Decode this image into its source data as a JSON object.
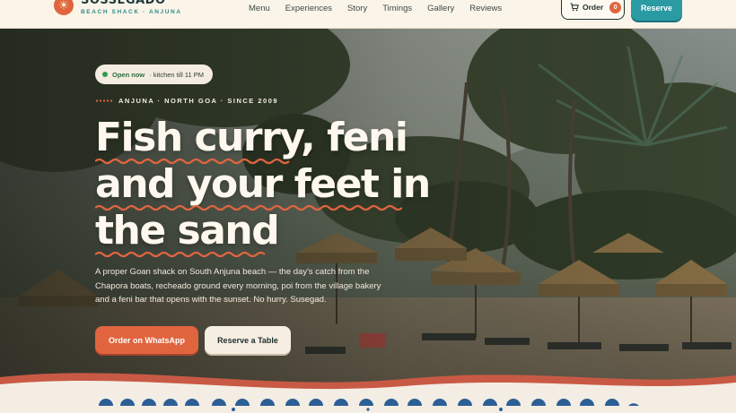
{
  "brand": {
    "name": "SOSSEGADO",
    "tagline": "BEACH SHACK · ANJUNA",
    "logo_icon": "sun-icon"
  },
  "nav": [
    "Menu",
    "Experiences",
    "Story",
    "Timings",
    "Gallery",
    "Reviews"
  ],
  "header_actions": {
    "order_label": "Order",
    "order_count": "0",
    "order_icon": "cart-icon",
    "reserve_label": "Reserve"
  },
  "hero": {
    "status_strong": "Open now",
    "status_rest": "· kitchen till 11 PM",
    "eyebrow": "ANJUNA · NORTH GOA · SINCE 2009",
    "headline": [
      "Fish curry, feni",
      "and your feet in",
      "the sand"
    ],
    "lede": "A proper Goan shack on South Anjuna beach — the day's catch from the Chapora boats, recheado ground every morning, poi from the village bakery and a feni bar that opens with the sunset. No hurry. Susegad.",
    "cta_primary": "Order on WhatsApp",
    "cta_secondary": "Reserve a Table"
  },
  "colors": {
    "accent": "#e0653f",
    "teal": "#2a9aa3",
    "cream": "#fbf4e8",
    "ink": "#1f2f30",
    "open_green": "#2f9a4e"
  }
}
